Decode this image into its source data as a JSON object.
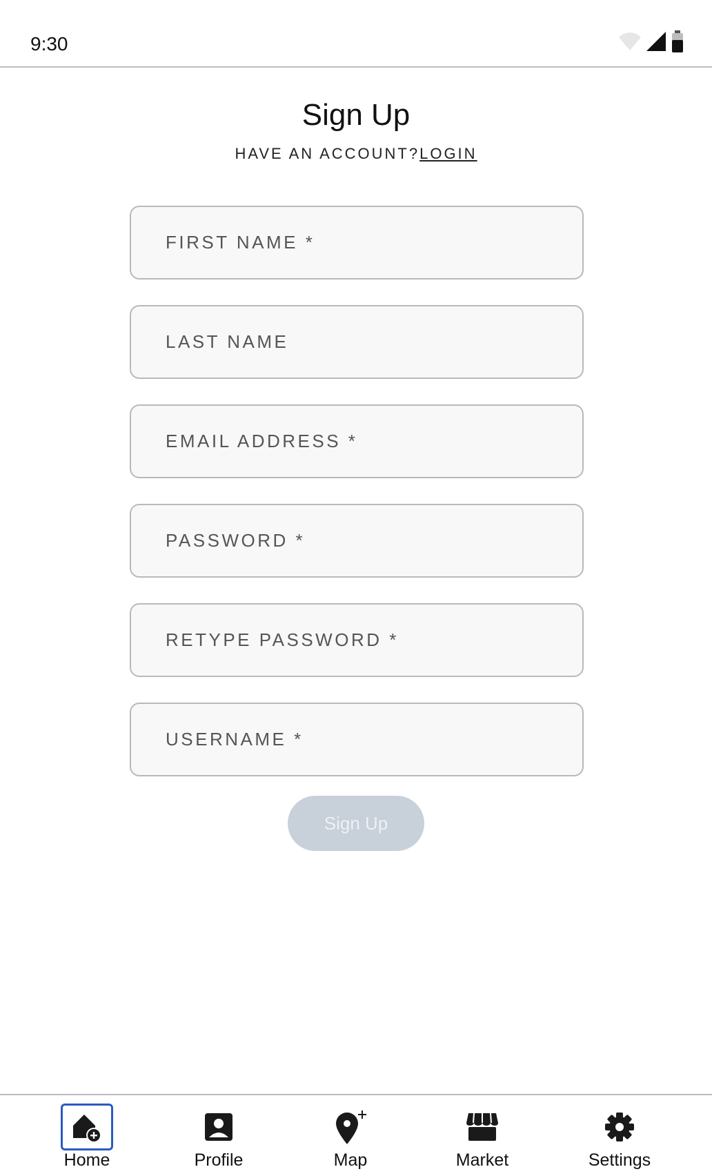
{
  "status_bar": {
    "time": "9:30"
  },
  "header": {
    "title": "Sign Up",
    "prompt": "HAVE AN ACCOUNT?",
    "login_link": "LOGIN"
  },
  "form": {
    "fields": [
      {
        "placeholder": "FIRST NAME *"
      },
      {
        "placeholder": "LAST NAME"
      },
      {
        "placeholder": "EMAIL ADDRESS *"
      },
      {
        "placeholder": "PASSWORD *"
      },
      {
        "placeholder": "RETYPE PASSWORD *"
      },
      {
        "placeholder": "USERNAME *"
      }
    ],
    "submit_label": "Sign Up"
  },
  "bottom_nav": {
    "items": [
      {
        "label": "Home",
        "icon": "home-add-icon",
        "active": true
      },
      {
        "label": "Profile",
        "icon": "profile-icon",
        "active": false
      },
      {
        "label": "Map",
        "icon": "map-pin-add-icon",
        "active": false
      },
      {
        "label": "Market",
        "icon": "storefront-icon",
        "active": false
      },
      {
        "label": "Settings",
        "icon": "gear-icon",
        "active": false
      }
    ]
  },
  "colors": {
    "active_nav_border": "#2a5bc0",
    "disabled_button": "#c8d0da",
    "field_background": "#f8f8f8"
  }
}
